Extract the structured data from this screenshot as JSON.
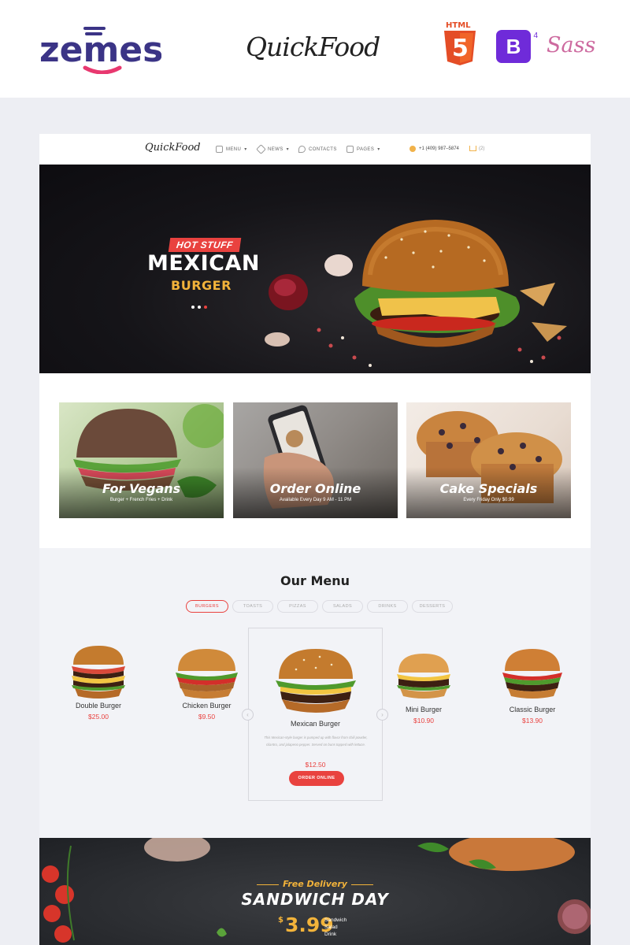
{
  "promo": {
    "zemes_logo": "zemes",
    "brand": "QuickFood",
    "html_badge": "HTML",
    "html_number": "5",
    "bootstrap_badge": "B",
    "bootstrap_version": "4",
    "sass_badge": "Sass"
  },
  "nav": {
    "logo": "QuickFood",
    "items": [
      {
        "label": "MENU",
        "icon": "burger-icon"
      },
      {
        "label": "NEWS",
        "icon": "tag-icon"
      },
      {
        "label": "CONTACTS",
        "icon": "location-icon"
      },
      {
        "label": "PAGES",
        "icon": "layers-icon"
      }
    ],
    "phone": "+1 (409) 987–5874",
    "cart_count": "(2)"
  },
  "hero": {
    "tag": "HOT STUFF",
    "title": "MEXICAN",
    "subtitle": "BURGER",
    "slides": 3,
    "active_slide": 3
  },
  "features": [
    {
      "title": "For Vegans",
      "text": "Burger + French Fries + Drink"
    },
    {
      "title": "Order Online",
      "text": "Available Every Day 9 AM - 11 PM"
    },
    {
      "title": "Cake Specials",
      "text": "Every Friday Only $0.99"
    }
  ],
  "menu": {
    "title": "Our Menu",
    "tabs": [
      "BURGERS",
      "TOASTS",
      "PIZZAS",
      "SALADS",
      "DRINKS",
      "DESSERTS"
    ],
    "active_tab": "BURGERS",
    "items": [
      {
        "name": "Double Burger",
        "price": "$25.00"
      },
      {
        "name": "Chicken Burger",
        "price": "$9.50"
      },
      {
        "name": "Mini Burger",
        "price": "$10.90"
      },
      {
        "name": "Classic Burger",
        "price": "$13.90"
      }
    ],
    "featured": {
      "name": "Mexican Burger",
      "description": "This Mexican-style burger is pumped up with flavor from chili powder, cilantro, and jalapeno pepper. Served on buns topped with lettuce.",
      "price": "$12.50",
      "button": "ORDER ONLINE"
    }
  },
  "sandwich": {
    "pre_title": "Free Delivery",
    "title": "SANDWICH DAY",
    "currency": "$",
    "price": "3.99",
    "includes": [
      "Sandwich",
      "Salad",
      "Drink"
    ]
  },
  "colors": {
    "accent": "#e9423f",
    "gold": "#f2b33a",
    "bootstrap": "#6f2bd9",
    "sass": "#cd6a9f",
    "html5": "#e44d26"
  }
}
